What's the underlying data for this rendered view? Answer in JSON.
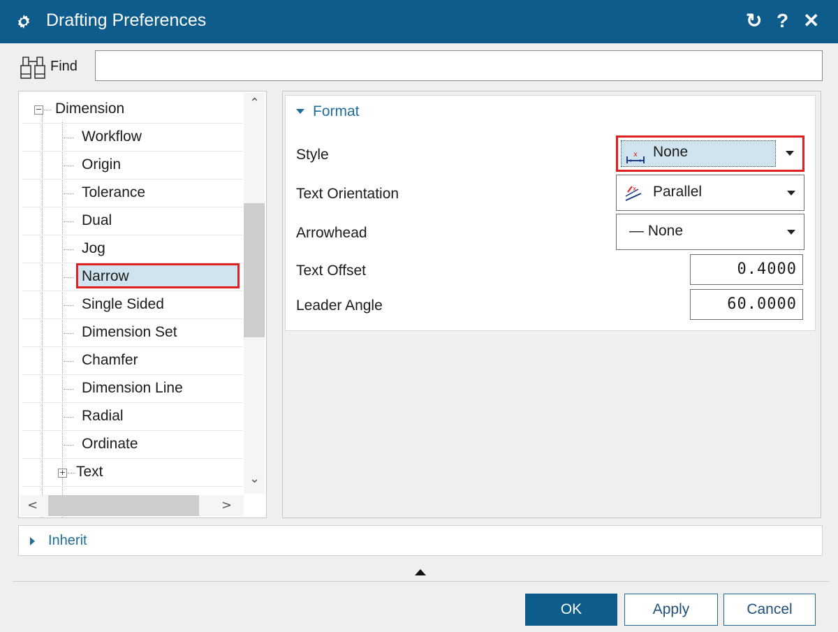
{
  "window": {
    "title": "Drafting Preferences",
    "reset_glyph": "↻",
    "help_glyph": "?",
    "close_glyph": "✕"
  },
  "find": {
    "label": "Find",
    "value": ""
  },
  "tree": {
    "items": [
      {
        "label": "Dimension",
        "level": 0,
        "expander": "−"
      },
      {
        "label": "Workflow",
        "level": 1
      },
      {
        "label": "Origin",
        "level": 1
      },
      {
        "label": "Tolerance",
        "level": 1
      },
      {
        "label": "Dual",
        "level": 1
      },
      {
        "label": "Jog",
        "level": 1
      },
      {
        "label": "Narrow",
        "level": 1,
        "selected": true
      },
      {
        "label": "Single Sided",
        "level": 1
      },
      {
        "label": "Dimension Set",
        "level": 1
      },
      {
        "label": "Chamfer",
        "level": 1
      },
      {
        "label": "Dimension Line",
        "level": 1
      },
      {
        "label": "Radial",
        "level": 1
      },
      {
        "label": "Ordinate",
        "level": 1
      },
      {
        "label": "Text",
        "level": 1,
        "expander": "+"
      }
    ],
    "scroll_up": "⌃",
    "scroll_down": "⌄",
    "scroll_left": "<",
    "scroll_right": ">"
  },
  "format": {
    "title": "Format",
    "style": {
      "label": "Style",
      "value": "None",
      "icon": "dimension-style-icon"
    },
    "text_orientation": {
      "label": "Text Orientation",
      "value": "Parallel",
      "icon": "text-orientation-icon"
    },
    "arrowhead": {
      "label": "Arrowhead",
      "value": "— None"
    },
    "text_offset": {
      "label": "Text Offset",
      "value": "0.4000"
    },
    "leader_angle": {
      "label": "Leader Angle",
      "value": "60.0000"
    }
  },
  "inherit": {
    "title": "Inherit"
  },
  "buttons": {
    "ok": "OK",
    "apply": "Apply",
    "cancel": "Cancel"
  },
  "colors": {
    "titlebar": "#0d5c8c",
    "accent": "#1f6d9c",
    "highlight_border": "#e02020",
    "selection_bg": "#cfe4ee"
  }
}
